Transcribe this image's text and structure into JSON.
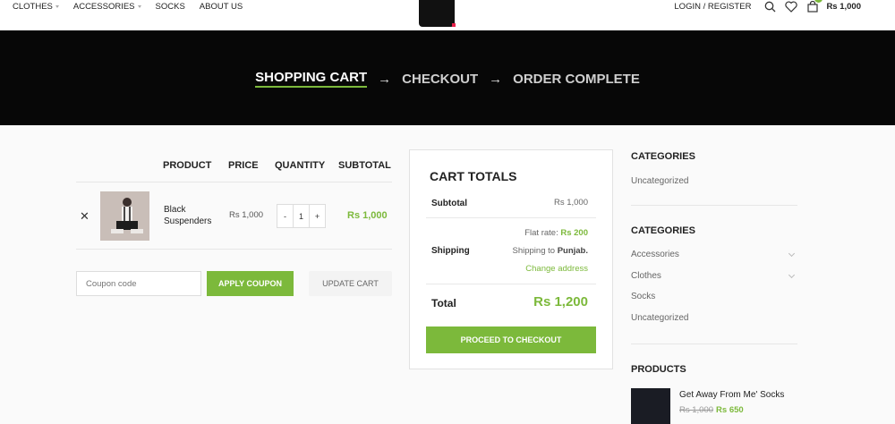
{
  "nav": {
    "items": [
      {
        "label": "CLOTHES",
        "has_dropdown": true
      },
      {
        "label": "ACCESSORIES",
        "has_dropdown": true
      },
      {
        "label": "SOCKS",
        "has_dropdown": false
      },
      {
        "label": "ABOUT US",
        "has_dropdown": false
      }
    ],
    "login": "LOGIN / REGISTER",
    "cart_count": "1",
    "cart_total": "Rs 1,000"
  },
  "steps": {
    "cart": "SHOPPING CART",
    "checkout": "CHECKOUT",
    "complete": "ORDER COMPLETE",
    "arrow": "→"
  },
  "table": {
    "headers": {
      "product": "PRODUCT",
      "price": "PRICE",
      "quantity": "QUANTITY",
      "subtotal": "SUBTOTAL"
    },
    "row": {
      "remove": "✕",
      "name": "Black Suspenders",
      "price": "Rs 1,000",
      "qty_minus": "-",
      "qty": "1",
      "qty_plus": "+",
      "subtotal": "Rs 1,000"
    }
  },
  "coupon": {
    "placeholder": "Coupon code",
    "apply": "APPLY COUPON",
    "update": "UPDATE CART"
  },
  "totals": {
    "title": "CART TOTALS",
    "subtotal_label": "Subtotal",
    "subtotal_value": "Rs 1,000",
    "shipping_label": "Shipping",
    "flat_rate_label": "Flat rate:",
    "flat_rate_value": "Rs 200",
    "shipping_to_label": "Shipping to",
    "shipping_to_value": "Punjab.",
    "change_address": "Change address",
    "total_label": "Total",
    "total_value": "Rs 1,200",
    "checkout": "PROCEED TO CHECKOUT"
  },
  "sidebar": {
    "categories_title_1": "CATEGORIES",
    "categories_1": [
      "Uncategorized"
    ],
    "categories_title_2": "CATEGORIES",
    "categories_2": [
      {
        "label": "Accessories",
        "expandable": true
      },
      {
        "label": "Clothes",
        "expandable": true
      },
      {
        "label": "Socks",
        "expandable": false
      },
      {
        "label": "Uncategorized",
        "expandable": false
      }
    ],
    "products_title": "PRODUCTS",
    "product": {
      "name": "Get Away From Me' Socks",
      "old_price": "Rs 1,000",
      "price": "Rs 650"
    }
  },
  "colors": {
    "accent": "#7cb93b",
    "hero_bg": "#070707"
  }
}
